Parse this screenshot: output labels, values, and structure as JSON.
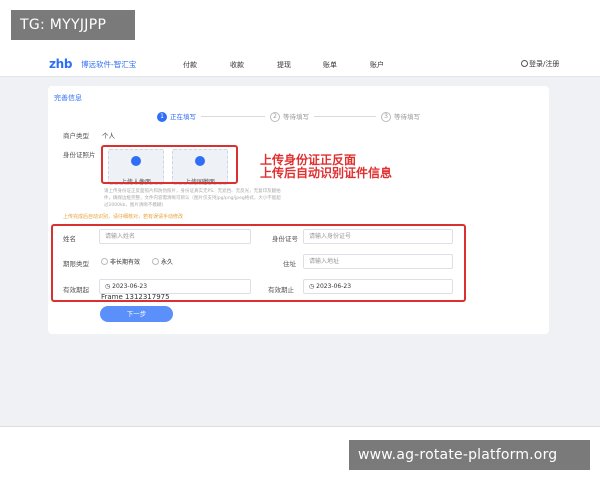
{
  "overlay": {
    "tag": "TG: MYYJJPP",
    "watermark": "www.ag-rotate-platform.org"
  },
  "navbar": {
    "logo": "zhb",
    "brand": "博远软件-智汇宝",
    "items": [
      "付款",
      "收款",
      "提现",
      "账单",
      "账户"
    ],
    "user_link": "登录/注册"
  },
  "form": {
    "title": "完善信息",
    "steps": [
      {
        "num": "1",
        "label": "正在填写"
      },
      {
        "num": "2",
        "label": "等待填写"
      },
      {
        "num": "3",
        "label": "等待填写"
      }
    ],
    "account_type_label": "商户类型",
    "account_type_value": "个人",
    "id_photo_label": "身份证照片",
    "upload_front": "上传人像面",
    "upload_back": "上传国徽面",
    "upload_hint": "请上传身份证正反面照片和防伪照片，身份证真实无PS、无遮挡、无反光，无复印及翻拍件，确保边框完整，文件内容需清晰可辨认（图片仅支持jpg/png/jpeg格式，大小不能超过2000kb，图片清晰不模糊)",
    "tip": "上传完成后自动识别，请仔细核对，若有误请手动修改",
    "name_label": "姓名",
    "name_placeholder": "请输入姓名",
    "id_label": "身份证号",
    "id_placeholder": "请输入身份证号",
    "validity_label": "期限类型",
    "validity_options": [
      "非长期有效",
      "永久"
    ],
    "address_label": "住址",
    "address_placeholder": "请输入地址",
    "start_label": "有效期起",
    "start_value": "2023-06-23",
    "end_label": "有效期止",
    "end_value": "2023-06-23",
    "frame_label": "Frame 1312317975",
    "next_button": "下一步"
  },
  "annotation": {
    "line1": "上传身份证正反面",
    "line2": "上传后自动识别证件信息"
  },
  "colors": {
    "accent": "#2f6ff6",
    "annotation_red": "#d93030",
    "button": "#5b8ff9"
  }
}
